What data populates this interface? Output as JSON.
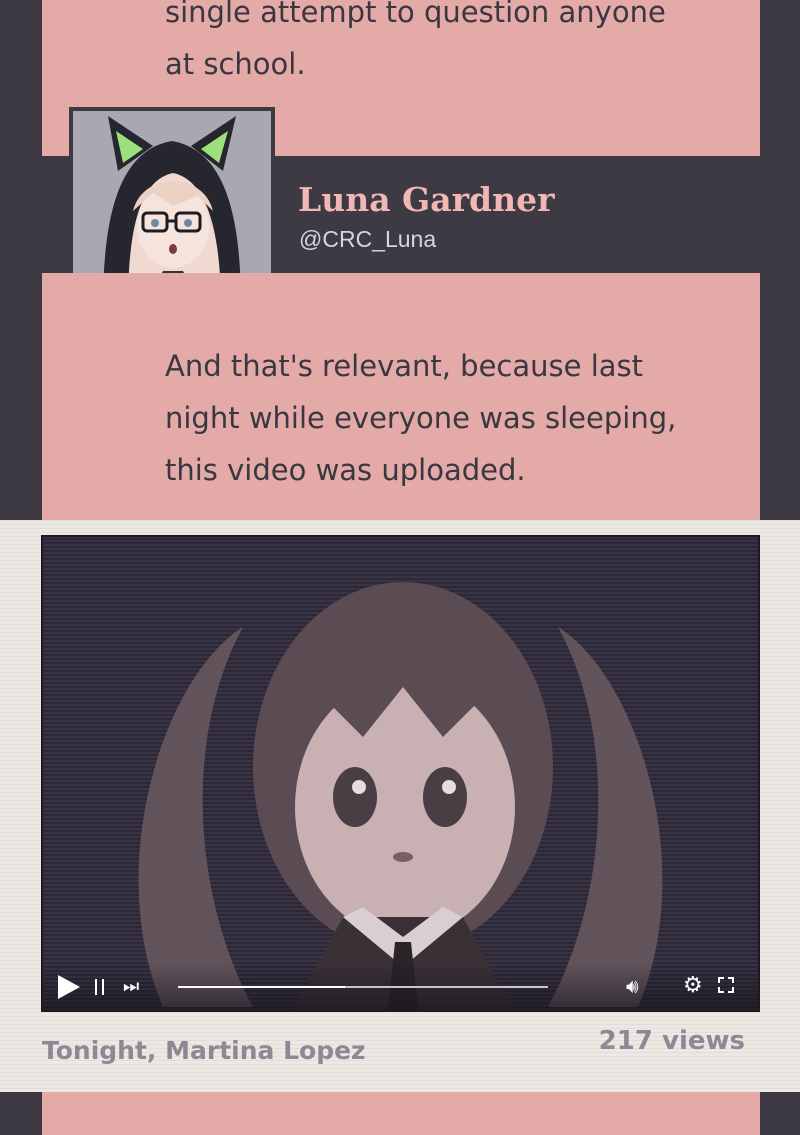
{
  "intro": {
    "text": "single attempt to question anyone\nat school."
  },
  "post": {
    "name": "Luna Gardner",
    "handle": "@CRC_Luna",
    "text": "And that's relevant, because last\nnight while everyone was sleeping,\nthis video was uploaded."
  },
  "video": {
    "title": "Tonight, Martina Lopez",
    "views": "217 views",
    "progress": 0.45,
    "icons": {
      "play": "play-icon",
      "pause": "pause-icon",
      "next": "next-icon",
      "volume": "volume-icon",
      "settings": "gear-icon",
      "fullscreen": "fullscreen-icon"
    }
  },
  "colors": {
    "panel": "#e3aaa8",
    "dark": "#3d3a44",
    "name": "#f2b7b4"
  }
}
